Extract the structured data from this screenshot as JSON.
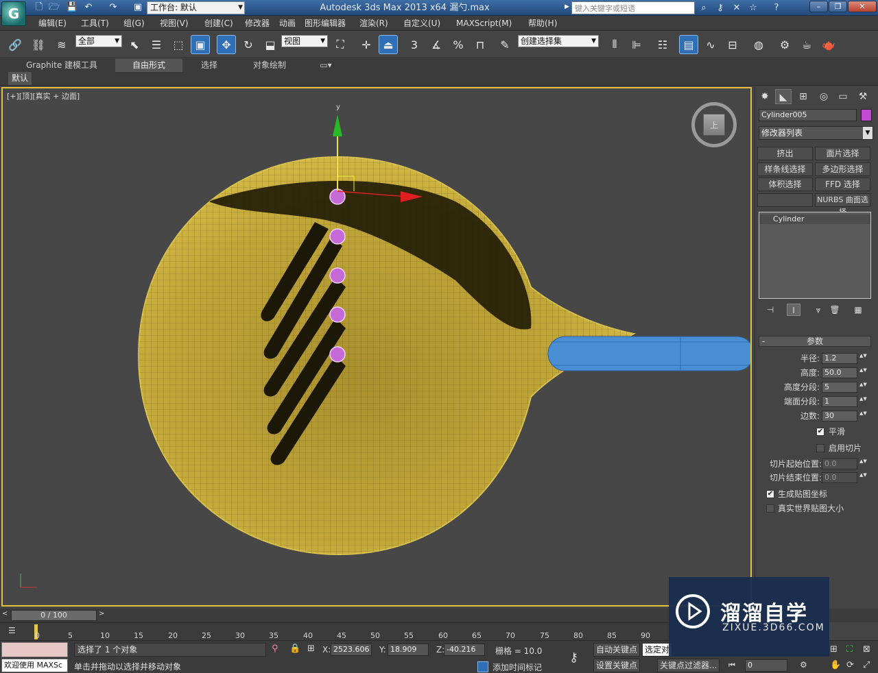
{
  "titlebar": {
    "workspace": "工作台: 默认",
    "title": "Autodesk 3ds Max  2013 x64      漏勺.max",
    "search_placeholder": "键入关键字或短语",
    "min": "–",
    "restore": "❐",
    "close": "✕"
  },
  "menu": [
    "编辑(E)",
    "工具(T)",
    "组(G)",
    "视图(V)",
    "创建(C)",
    "修改器",
    "动画",
    "图形编辑器",
    "渲染(R)",
    "自定义(U)",
    "MAXScript(M)",
    "帮助(H)"
  ],
  "toolbar": {
    "filter": "全部",
    "ref_coord": "视图",
    "selection_set": "创建选择集"
  },
  "ribbon": {
    "tabs": [
      "Graphite 建模工具",
      "自由形式",
      "选择",
      "对象绘制"
    ],
    "sub": "默认"
  },
  "viewport": {
    "label": "[+][顶][真实 + 边面]",
    "cube_face": "上",
    "axis_y": "y"
  },
  "command_panel": {
    "object_name": "Cylinder005",
    "object_color": "#c44bd3",
    "modifier_list": "修改器列表",
    "mod_buttons": [
      "挤出",
      "面片选择",
      "样条线选择",
      "多边形选择",
      "体积选择",
      "FFD 选择",
      "",
      "NURBS 曲面选择"
    ],
    "stack_item": "Cylinder",
    "params_title": "参数",
    "params": [
      {
        "label": "半径:",
        "value": "1.2"
      },
      {
        "label": "高度:",
        "value": "50.0"
      },
      {
        "label": "高度分段:",
        "value": "5"
      },
      {
        "label": "端面分段:",
        "value": "1"
      },
      {
        "label": "边数:",
        "value": "30"
      }
    ],
    "smooth": "平滑",
    "slice_on": "启用切片",
    "slice_from_label": "切片起始位置:",
    "slice_from": "0.0",
    "slice_to_label": "切片结束位置:",
    "slice_to": "0.0",
    "gen_map": "生成贴图坐标",
    "real_world": "真实世界贴图大小"
  },
  "timeline": {
    "slider": "0 / 100",
    "ticks": [
      "0",
      "5",
      "10",
      "15",
      "20",
      "25",
      "30",
      "35",
      "40",
      "45",
      "50",
      "55",
      "60",
      "65",
      "70",
      "75",
      "80",
      "85",
      "90"
    ]
  },
  "status": {
    "welcome": "欢迎使用 MAXSc",
    "selected": "选择了 1 个对象",
    "prompt": "单击并拖动以选择并移动对象",
    "x_label": "X:",
    "x": "2523.606",
    "y_label": "Y:",
    "y": "18.909",
    "z_label": "Z:",
    "z": "-40.216",
    "grid": "栅格 = 10.0",
    "add_tag": "添加时间标记",
    "auto_key": "自动关键点",
    "selected_obj": "选定对",
    "set_key": "设置关键点",
    "key_filter": "关键点过滤器...",
    "frame": "0"
  },
  "watermark": {
    "title": "溜溜自学",
    "url": "ZIXUE.3D66.COM"
  }
}
